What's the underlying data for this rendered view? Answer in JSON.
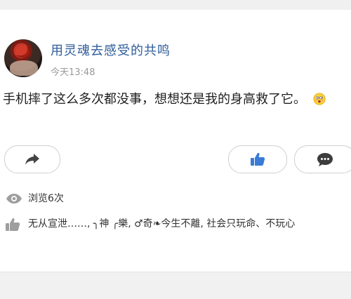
{
  "post": {
    "username": "用灵魂去感受的共鸣",
    "time": "今天13:48",
    "content": "手机摔了这么多次都没事，想想还是我的身高救了它。",
    "emoji": "embarrassed-face-emoji"
  },
  "stats": {
    "views": "浏览6次",
    "likers": "无从宣泄……, ╮神 ╭樂, ♂奇❧今生不離, 社会只玩命、不玩心"
  },
  "colors": {
    "username": "#2f5d9a",
    "like_icon": "#3a7bd5",
    "icon_gray": "#9e9e9e"
  },
  "icons": {
    "share": "share-arrow-icon",
    "like": "thumbs-up-icon",
    "comment": "comment-bubble-icon",
    "views": "eye-icon",
    "likes": "thumbs-up-icon"
  }
}
